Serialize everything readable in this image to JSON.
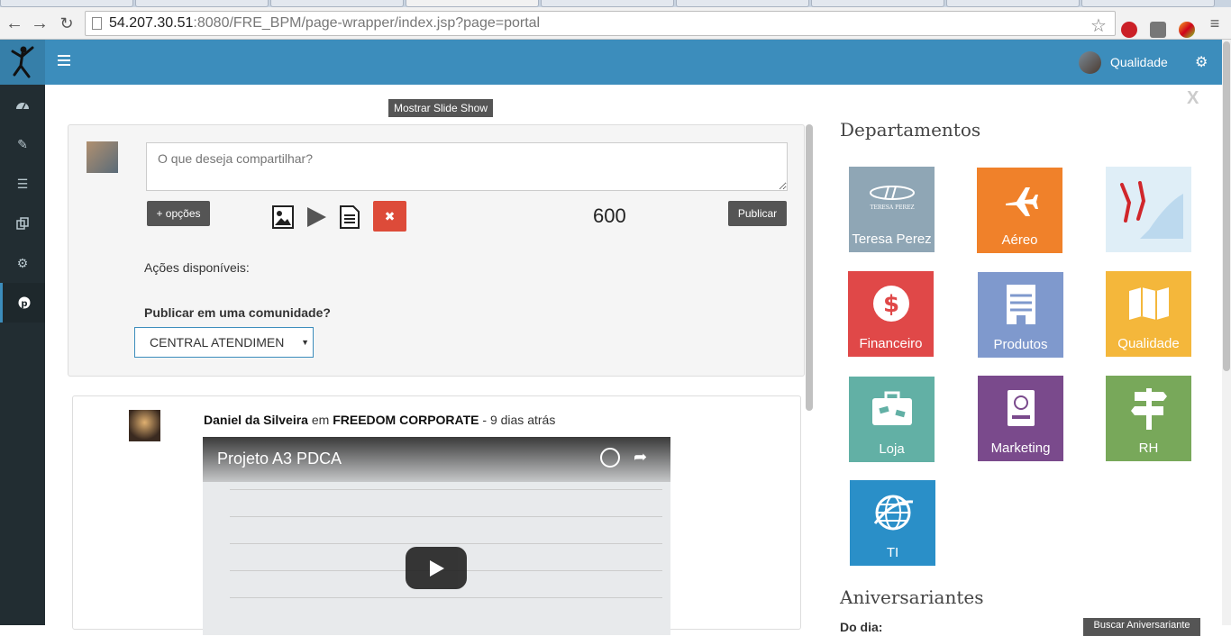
{
  "browser": {
    "url_host": "54.207.30.51",
    "url_rest": ":8080/FRE_BPM/page-wrapper/index.jsp?page=portal"
  },
  "header": {
    "user_name": "Qualidade"
  },
  "main": {
    "slideshow_label": "Mostrar Slide Show",
    "share_placeholder": "O que deseja compartilhar?",
    "options_label": "+ opções",
    "publish_label": "Publicar",
    "char_counter": "600",
    "actions_label": "Ações disponíveis:",
    "community_label": "Publicar em uma comunidade?",
    "community_selected": "CENTRAL ATENDIMEN"
  },
  "feed": {
    "author": "Daniel da Silveira",
    "connector": " em ",
    "community": "FREEDOM CORPORATE",
    "time": " - 9 dias atrás",
    "video_title": "Projeto A3 PDCA"
  },
  "right_panel": {
    "close_label": "X",
    "departments_heading": "Departamentos",
    "departments": [
      {
        "label": "Teresa Perez",
        "color": "#8fa6b5",
        "icon": "teresa-perez-logo"
      },
      {
        "label": "Aéreo",
        "color": "#f0812a",
        "icon": "airplane-icon"
      },
      {
        "label": "",
        "color": "#dfeef7",
        "icon": "birds-image"
      },
      {
        "label": "Financeiro",
        "color": "#e04848",
        "icon": "dollar-icon"
      },
      {
        "label": "Produtos",
        "color": "#7f99cd",
        "icon": "hotel-icon"
      },
      {
        "label": "Qualidade",
        "color": "#f4b73b",
        "icon": "map-icon"
      },
      {
        "label": "Loja",
        "color": "#62b0a5",
        "icon": "suitcase-icon"
      },
      {
        "label": "Marketing",
        "color": "#7a4a8c",
        "icon": "passport-icon"
      },
      {
        "label": "RH",
        "color": "#78a85a",
        "icon": "signpost-icon"
      },
      {
        "label": "TI",
        "color": "#2a8fc8",
        "icon": "globe-icon"
      }
    ],
    "birthdays_heading": "Aniversariantes",
    "birthdays_day_label": "Do dia:",
    "birthday_search_label": "Buscar Aniversariante"
  }
}
